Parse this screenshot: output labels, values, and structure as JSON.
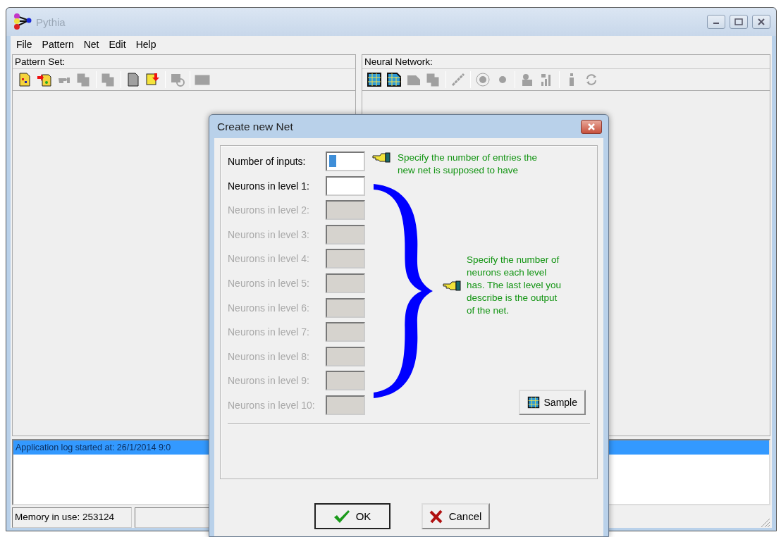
{
  "window": {
    "title": "Pythia"
  },
  "menu": [
    {
      "label": "File"
    },
    {
      "label": "Pattern"
    },
    {
      "label": "Net"
    },
    {
      "label": "Edit"
    },
    {
      "label": "Help"
    }
  ],
  "panels": [
    {
      "title": "Pattern Set:",
      "toolbar": [
        {
          "kind": "button",
          "disabled": false
        },
        {
          "kind": "button",
          "disabled": false
        },
        {
          "kind": "button",
          "disabled": true
        },
        {
          "kind": "button",
          "disabled": true
        },
        {
          "kind": "separator"
        },
        {
          "kind": "button",
          "disabled": true
        },
        {
          "kind": "separator"
        },
        {
          "kind": "button",
          "disabled": true
        },
        {
          "kind": "button",
          "disabled": false
        },
        {
          "kind": "separator"
        },
        {
          "kind": "button",
          "disabled": true
        },
        {
          "kind": "separator"
        },
        {
          "kind": "button",
          "disabled": true
        }
      ]
    },
    {
      "title": "Neural Network:",
      "toolbar": [
        {
          "kind": "button",
          "disabled": false
        },
        {
          "kind": "button",
          "disabled": false
        },
        {
          "kind": "button",
          "disabled": true
        },
        {
          "kind": "button",
          "disabled": true
        },
        {
          "kind": "separator"
        },
        {
          "kind": "button",
          "disabled": true
        },
        {
          "kind": "separator"
        },
        {
          "kind": "button",
          "disabled": true
        },
        {
          "kind": "button",
          "disabled": true
        },
        {
          "kind": "separator"
        },
        {
          "kind": "button",
          "disabled": true
        },
        {
          "kind": "button",
          "disabled": true
        },
        {
          "kind": "separator"
        },
        {
          "kind": "button",
          "disabled": true
        },
        {
          "kind": "button",
          "disabled": true
        }
      ]
    }
  ],
  "log": [
    {
      "text": "Application log started at: 26/1/2014 9:0",
      "selected": true
    }
  ],
  "status_bar": [
    {
      "text": "Memory in use: 253124"
    }
  ],
  "dialog": {
    "title": "Create new Net",
    "fields": [
      {
        "label": "Number of inputs:",
        "disabled": false,
        "focused": true
      },
      {
        "label": "Neurons in level 1:",
        "disabled": false,
        "focused": false
      },
      {
        "label": "Neurons in level 2:",
        "disabled": true,
        "focused": false
      },
      {
        "label": "Neurons in level 3:",
        "disabled": true,
        "focused": false
      },
      {
        "label": "Neurons in level 4:",
        "disabled": true,
        "focused": false
      },
      {
        "label": "Neurons in level 5:",
        "disabled": true,
        "focused": false
      },
      {
        "label": "Neurons in level 6:",
        "disabled": true,
        "focused": false
      },
      {
        "label": "Neurons in level 7:",
        "disabled": true,
        "focused": false
      },
      {
        "label": "Neurons in level 8:",
        "disabled": true,
        "focused": false
      },
      {
        "label": "Neurons in level 9:",
        "disabled": true,
        "focused": false
      },
      {
        "label": "Neurons in level 10:",
        "disabled": true,
        "focused": false
      }
    ],
    "inputs_hint": "Specify the number of entries the new net is supposed to have",
    "levels_hint": "Specify the number of neurons each level has. The last level you describe is the output of the net.",
    "sample_button": "Sample",
    "buttons": [
      {
        "label": "OK",
        "kind": "ok"
      },
      {
        "label": "Cancel",
        "kind": "cancel"
      }
    ]
  }
}
